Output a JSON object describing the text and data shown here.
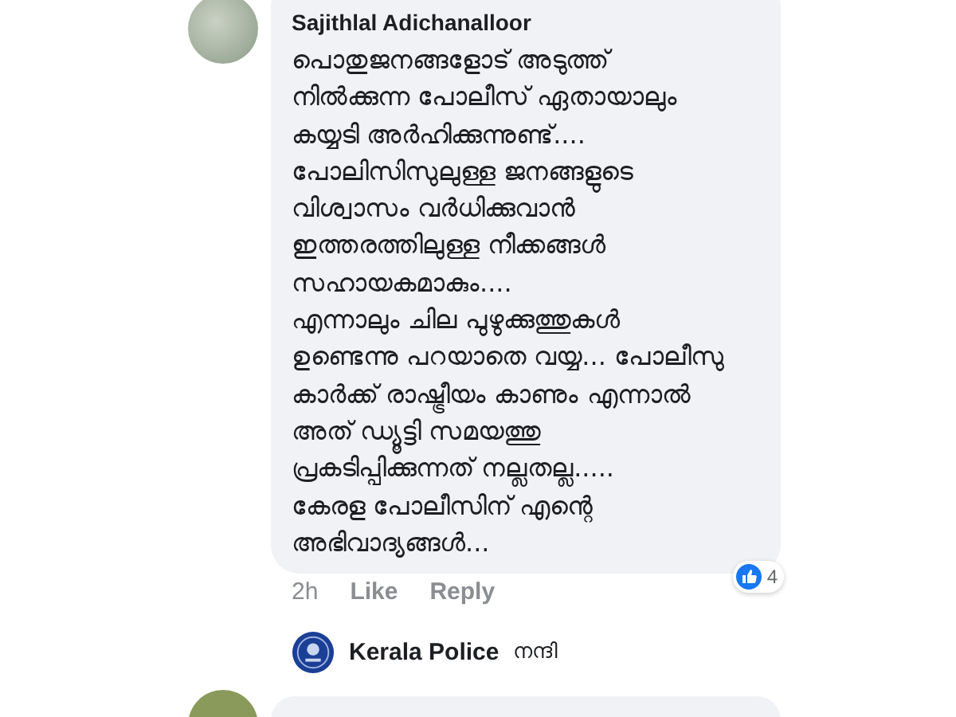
{
  "comment": {
    "author": "Sajithlal Adichanalloor",
    "text": "പൊതുജനങ്ങളോട് അടുത്ത്\nനിൽക്കുന്ന പോലീസ് ഏതായാലും\nകയ്യടി അർഹിക്കുന്നുണ്ട്....\nപോലിസിസുലുള്ള ജനങ്ങളുടെ\nവിശ്വാസം വർധിക്കുവാൻ\nഇത്തരത്തിലുള്ള നീക്കങ്ങൾ\nസഹായകമാകും....\nഎന്നാലും ചില പുഴുക്കുത്തുകൾ\nഉണ്ടെന്നു പറയാതെ വയ്യ... പോലീസു\nകാർക്ക് രാഷ്ട്രീയം കാണും എന്നാൽ\nഅത് ഡ്യൂട്ടി സമയത്തു\nപ്രകടിപ്പിക്കുന്നത് നല്ലതല്ല.....\nകേരള പോലീസിന് എന്റെ\nഅഭിവാദ്യങ്ങൾ...",
    "time": "2h",
    "actions": [
      "Like",
      "Reply"
    ],
    "reaction_count": "4"
  },
  "reply": {
    "author": "Kerala Police",
    "text": "നന്ദി"
  }
}
